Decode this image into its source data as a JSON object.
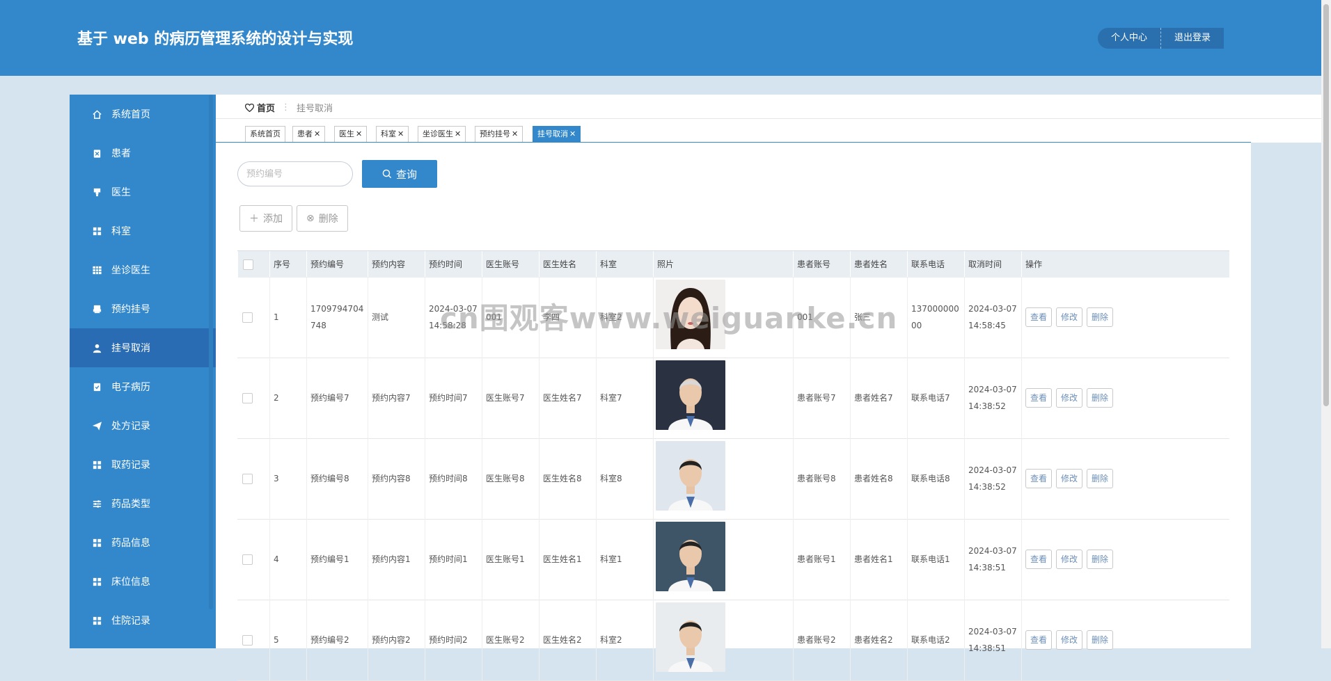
{
  "header": {
    "title": "基于 web 的病历管理系统的设计与实现",
    "profile_label": "个人中心",
    "logout_label": "退出登录"
  },
  "sidebar": {
    "items": [
      {
        "label": "系统首页",
        "icon": "home-icon"
      },
      {
        "label": "患者",
        "icon": "clipboard-icon"
      },
      {
        "label": "医生",
        "icon": "stamp-icon"
      },
      {
        "label": "科室",
        "icon": "grid-icon"
      },
      {
        "label": "坐诊医生",
        "icon": "table-icon"
      },
      {
        "label": "预约挂号",
        "icon": "printer-icon"
      },
      {
        "label": "挂号取消",
        "icon": "user-icon",
        "active": true
      },
      {
        "label": "电子病历",
        "icon": "checklist-icon"
      },
      {
        "label": "处方记录",
        "icon": "send-icon"
      },
      {
        "label": "取药记录",
        "icon": "grid-icon"
      },
      {
        "label": "药品类型",
        "icon": "sliders-icon"
      },
      {
        "label": "药品信息",
        "icon": "grid-icon"
      },
      {
        "label": "床位信息",
        "icon": "grid-icon"
      },
      {
        "label": "住院记录",
        "icon": "grid-icon"
      }
    ]
  },
  "breadcrumb": {
    "home": "首页",
    "separator": "⋮",
    "current": "挂号取消"
  },
  "tabs": [
    {
      "label": "系统首页",
      "closable": false
    },
    {
      "label": "患者",
      "closable": true
    },
    {
      "label": "医生",
      "closable": true
    },
    {
      "label": "科室",
      "closable": true
    },
    {
      "label": "坐诊医生",
      "closable": true
    },
    {
      "label": "预约挂号",
      "closable": true
    },
    {
      "label": "挂号取消",
      "closable": true,
      "active": true
    }
  ],
  "tab_close_glyph": "✕",
  "search": {
    "placeholder": "预约编号",
    "value": "",
    "button_label": "查询"
  },
  "toolbar": {
    "add_label": "添加",
    "delete_label": "删除"
  },
  "table": {
    "columns": [
      "",
      "序号",
      "预约编号",
      "预约内容",
      "预约时间",
      "医生账号",
      "医生姓名",
      "科室",
      "照片",
      "患者账号",
      "患者姓名",
      "联系电话",
      "取消时间",
      "操作"
    ],
    "row_actions": [
      "查看",
      "修改",
      "删除"
    ],
    "rows": [
      {
        "no": "1",
        "booking_no": "1709794704748",
        "content": "测试",
        "time": "2024-03-07 14:58:28",
        "doc_acct": "001",
        "doc_name": "李四",
        "dept": "科室2",
        "photo": "female-portrait",
        "pat_acct": "001",
        "pat_name": "张三",
        "phone": "13700000000",
        "cancel_time": "2024-03-07 14:58:45"
      },
      {
        "no": "2",
        "booking_no": "预约编号7",
        "content": "预约内容7",
        "time": "预约时间7",
        "doc_acct": "医生账号7",
        "doc_name": "医生姓名7",
        "dept": "科室7",
        "photo": "doctor-portrait-1",
        "pat_acct": "患者账号7",
        "pat_name": "患者姓名7",
        "phone": "联系电话7",
        "cancel_time": "2024-03-07 14:38:52"
      },
      {
        "no": "3",
        "booking_no": "预约编号8",
        "content": "预约内容8",
        "time": "预约时间8",
        "doc_acct": "医生账号8",
        "doc_name": "医生姓名8",
        "dept": "科室8",
        "photo": "doctor-portrait-2",
        "pat_acct": "患者账号8",
        "pat_name": "患者姓名8",
        "phone": "联系电话8",
        "cancel_time": "2024-03-07 14:38:52"
      },
      {
        "no": "4",
        "booking_no": "预约编号1",
        "content": "预约内容1",
        "time": "预约时间1",
        "doc_acct": "医生账号1",
        "doc_name": "医生姓名1",
        "dept": "科室1",
        "photo": "doctor-portrait-3",
        "pat_acct": "患者账号1",
        "pat_name": "患者姓名1",
        "phone": "联系电话1",
        "cancel_time": "2024-03-07 14:38:51"
      },
      {
        "no": "5",
        "booking_no": "预约编号2",
        "content": "预约内容2",
        "time": "预约时间2",
        "doc_acct": "医生账号2",
        "doc_name": "医生姓名2",
        "dept": "科室2",
        "photo": "doctor-portrait-4",
        "pat_acct": "患者账号2",
        "pat_name": "患者姓名2",
        "phone": "联系电话2",
        "cancel_time": "2024-03-07 14:38:51"
      }
    ]
  },
  "watermark": "cn围观客www.weiguanke.cn",
  "colors": {
    "primary": "#3388cc",
    "active_nav": "#2a6cb3",
    "page_bg": "#d6e4f0"
  }
}
